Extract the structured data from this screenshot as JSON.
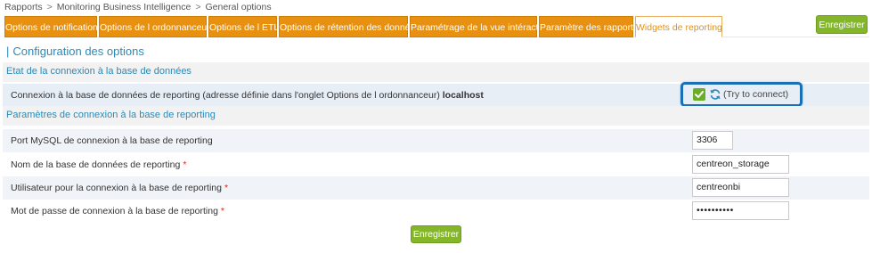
{
  "breadcrumb": {
    "items": [
      "Rapports",
      "Monitoring Business Intelligence",
      "General options"
    ],
    "separator": ">"
  },
  "tabs": [
    {
      "label": "Options de notification",
      "active": false
    },
    {
      "label": "Options de l ordonnanceur",
      "active": false
    },
    {
      "label": "Options de l ETL",
      "active": false
    },
    {
      "label": "Options de rétention des données",
      "active": false
    },
    {
      "label": "Paramétrage de la vue intéractive",
      "active": false
    },
    {
      "label": "Paramètre des rapports",
      "active": false
    },
    {
      "label": "Widgets de reporting",
      "active": true
    }
  ],
  "top_save_label": "Enregistrer",
  "section_title": "Configuration des options",
  "db_connection_header": "Etat de la connexion à la base de données",
  "connection_row": {
    "label": "Connexion à la base de données de reporting (adresse définie dans l'onglet Options de l ordonnanceur)",
    "host": "localhost",
    "status_icon": "check-icon",
    "refresh_icon": "refresh-icon",
    "try_label": "(Try to connect)"
  },
  "params_header": "Paramètres de connexion à la base de reporting",
  "fields": {
    "port": {
      "label": "Port MySQL de connexion à la base de reporting",
      "value": "3306",
      "required": false
    },
    "db_name": {
      "label": "Nom de la base de données de reporting",
      "value": "centreon_storage",
      "required": true
    },
    "user": {
      "label": "Utilisateur pour la connexion à la base de reporting",
      "value": "centreonbi",
      "required": true
    },
    "password": {
      "label": "Mot de passe de connexion à la base de reporting",
      "value": "••••••••••",
      "required": true
    }
  },
  "required_marker": "*",
  "bottom_save_label": "Enregistrer",
  "colors": {
    "tab_orange": "#e8900f",
    "save_green": "#83b729",
    "link_blue": "#2a8ab8",
    "highlight_blue": "#1a6fb5",
    "required_red": "#d9261c"
  }
}
